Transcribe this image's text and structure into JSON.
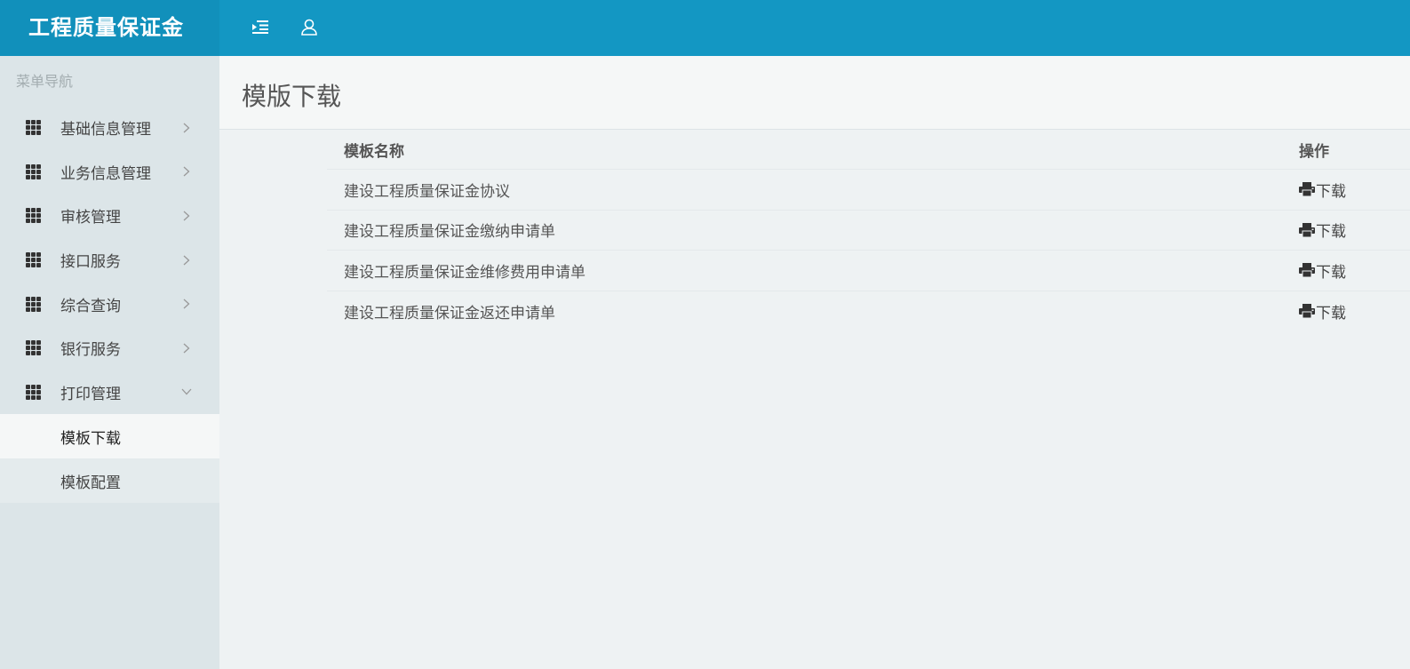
{
  "app": {
    "title": "工程质量保证金"
  },
  "topbar": {
    "menu_icon": "indent-icon",
    "user_icon": "user-icon"
  },
  "sidebar": {
    "header": "菜单导航",
    "items": [
      {
        "label": "基础信息管理",
        "expanded": false
      },
      {
        "label": "业务信息管理",
        "expanded": false
      },
      {
        "label": "审核管理",
        "expanded": false
      },
      {
        "label": "接口服务",
        "expanded": false
      },
      {
        "label": "综合查询",
        "expanded": false
      },
      {
        "label": "银行服务",
        "expanded": false
      },
      {
        "label": "打印管理",
        "expanded": true
      }
    ],
    "subitems": [
      {
        "label": "模板下载",
        "active": true
      },
      {
        "label": "模板配置",
        "active": false
      }
    ]
  },
  "page": {
    "title": "模版下载"
  },
  "table": {
    "headers": {
      "name": "模板名称",
      "op": "操作"
    },
    "rows": [
      {
        "name": "建设工程质量保证金协议",
        "action": "下载"
      },
      {
        "name": "建设工程质量保证金缴纳申请单",
        "action": "下载"
      },
      {
        "name": "建设工程质量保证金维修费用申请单",
        "action": "下载"
      },
      {
        "name": "建设工程质量保证金返还申请单",
        "action": "下载"
      }
    ]
  },
  "colors": {
    "topbar": "#1397c3",
    "brand_bg": "#1190bb",
    "sidebar": "#dce5e8"
  }
}
